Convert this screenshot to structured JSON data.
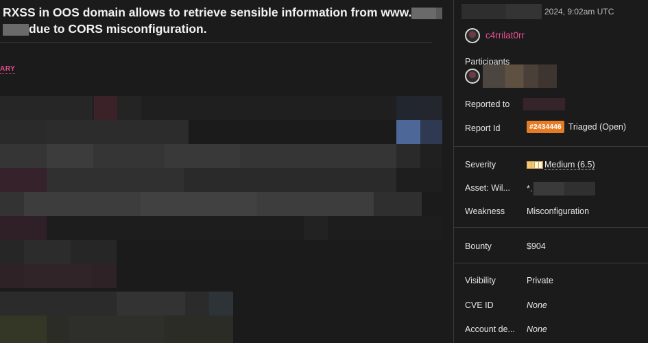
{
  "report": {
    "title_line1": "RXSS in OOS domain allows to retrieve sensible information from www.",
    "title_line2": "due to CORS misconfiguration.",
    "summary_tab": "ARY"
  },
  "sidebar": {
    "date_suffix": "2024, 9:02am UTC",
    "reporter": "c4rrilat0rr",
    "participants_label": "Participants",
    "reported_to_label": "Reported to",
    "report_id_label": "Report Id",
    "report_id": "#2434446",
    "report_state": "Triaged (Open)",
    "severity_label": "Severity",
    "severity_value": "Medium (6.5)",
    "asset_label": "Asset: Wil...",
    "asset_value": "*.",
    "weakness_label": "Weakness",
    "weakness_value": "Misconfiguration",
    "bounty_label": "Bounty",
    "bounty_value": "$904",
    "visibility_label": "Visibility",
    "visibility_value": "Private",
    "cve_label": "CVE ID",
    "cve_value": "None",
    "account_label": "Account de...",
    "account_value": "None"
  },
  "colors": {
    "accent_pink": "#e8508e",
    "badge_orange": "#e57c25",
    "background": "#1b1b1b",
    "divider": "#3a3a3a"
  }
}
